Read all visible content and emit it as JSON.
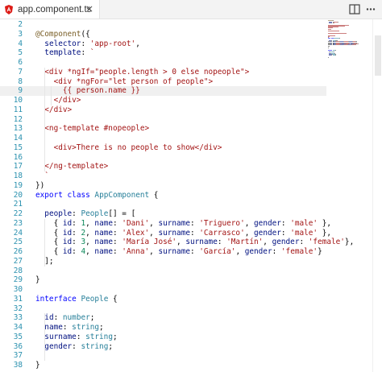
{
  "tab": {
    "filename": "app.component.ts",
    "close_glyph": "×",
    "icon": "angular-icon"
  },
  "toolbar": {
    "split_icon": "split-editor-icon",
    "more_icon": "more-actions-icon"
  },
  "editor": {
    "current_line": 9,
    "lines": [
      {
        "n": "2",
        "t": []
      },
      {
        "n": "3",
        "t": [
          [
            "t-deco",
            "@Component"
          ],
          [
            "t-pun",
            "({"
          ]
        ]
      },
      {
        "n": "4",
        "t": [
          [
            "t-pun",
            "  "
          ],
          [
            "t-prop",
            "selector"
          ],
          [
            "t-pun",
            ": "
          ],
          [
            "t-str",
            "'app-root'"
          ],
          [
            "t-pun",
            ","
          ]
        ]
      },
      {
        "n": "5",
        "t": [
          [
            "t-pun",
            "  "
          ],
          [
            "t-prop",
            "template"
          ],
          [
            "t-pun",
            ": "
          ],
          [
            "t-str",
            "`"
          ]
        ]
      },
      {
        "n": "6",
        "t": []
      },
      {
        "n": "7",
        "t": [
          [
            "t-str",
            "  <div *ngIf=\"people.length > 0 else nopeople\">"
          ]
        ]
      },
      {
        "n": "8",
        "t": [
          [
            "t-str",
            "    <div *ngFor=\"let person of people\">"
          ]
        ]
      },
      {
        "n": "9",
        "t": [
          [
            "t-str",
            "      {{ person.name }}"
          ]
        ]
      },
      {
        "n": "10",
        "t": [
          [
            "t-str",
            "    </div>"
          ]
        ]
      },
      {
        "n": "11",
        "t": [
          [
            "t-str",
            "  </div>"
          ]
        ]
      },
      {
        "n": "12",
        "t": []
      },
      {
        "n": "13",
        "t": [
          [
            "t-str",
            "  <ng-template #nopeople>"
          ]
        ]
      },
      {
        "n": "14",
        "t": []
      },
      {
        "n": "15",
        "t": [
          [
            "t-str",
            "    <div>There is no people to show</div>"
          ]
        ]
      },
      {
        "n": "16",
        "t": []
      },
      {
        "n": "17",
        "t": [
          [
            "t-str",
            "  </ng-template>"
          ]
        ]
      },
      {
        "n": "18",
        "t": [
          [
            "t-str",
            "  `"
          ]
        ]
      },
      {
        "n": "19",
        "t": [
          [
            "t-pun",
            "})"
          ]
        ]
      },
      {
        "n": "20",
        "t": [
          [
            "t-key",
            "export"
          ],
          [
            "t-pun",
            " "
          ],
          [
            "t-key",
            "class"
          ],
          [
            "t-pun",
            " "
          ],
          [
            "t-type",
            "AppComponent"
          ],
          [
            "t-pun",
            " {"
          ]
        ]
      },
      {
        "n": "21",
        "t": []
      },
      {
        "n": "22",
        "t": [
          [
            "t-pun",
            "  "
          ],
          [
            "t-prop",
            "people"
          ],
          [
            "t-pun",
            ": "
          ],
          [
            "t-type",
            "People"
          ],
          [
            "t-pun",
            "[] = ["
          ]
        ]
      },
      {
        "n": "23",
        "t": [
          [
            "t-pun",
            "    { "
          ],
          [
            "t-prop",
            "id"
          ],
          [
            "t-pun",
            ": "
          ],
          [
            "t-num",
            "1"
          ],
          [
            "t-pun",
            ", "
          ],
          [
            "t-prop",
            "name"
          ],
          [
            "t-pun",
            ": "
          ],
          [
            "t-str",
            "'Dani'"
          ],
          [
            "t-pun",
            ", "
          ],
          [
            "t-prop",
            "surname"
          ],
          [
            "t-pun",
            ": "
          ],
          [
            "t-str",
            "'Triguero'"
          ],
          [
            "t-pun",
            ", "
          ],
          [
            "t-prop",
            "gender"
          ],
          [
            "t-pun",
            ": "
          ],
          [
            "t-str",
            "'male'"
          ],
          [
            "t-pun",
            " },"
          ]
        ]
      },
      {
        "n": "24",
        "t": [
          [
            "t-pun",
            "    { "
          ],
          [
            "t-prop",
            "id"
          ],
          [
            "t-pun",
            ": "
          ],
          [
            "t-num",
            "2"
          ],
          [
            "t-pun",
            ", "
          ],
          [
            "t-prop",
            "name"
          ],
          [
            "t-pun",
            ": "
          ],
          [
            "t-str",
            "'Alex'"
          ],
          [
            "t-pun",
            ", "
          ],
          [
            "t-prop",
            "surname"
          ],
          [
            "t-pun",
            ": "
          ],
          [
            "t-str",
            "'Carrasco'"
          ],
          [
            "t-pun",
            ", "
          ],
          [
            "t-prop",
            "gender"
          ],
          [
            "t-pun",
            ": "
          ],
          [
            "t-str",
            "'male'"
          ],
          [
            "t-pun",
            " },"
          ]
        ]
      },
      {
        "n": "25",
        "t": [
          [
            "t-pun",
            "    { "
          ],
          [
            "t-prop",
            "id"
          ],
          [
            "t-pun",
            ": "
          ],
          [
            "t-num",
            "3"
          ],
          [
            "t-pun",
            ", "
          ],
          [
            "t-prop",
            "name"
          ],
          [
            "t-pun",
            ": "
          ],
          [
            "t-str",
            "'María José'"
          ],
          [
            "t-pun",
            ", "
          ],
          [
            "t-prop",
            "surname"
          ],
          [
            "t-pun",
            ": "
          ],
          [
            "t-str",
            "'Martín'"
          ],
          [
            "t-pun",
            ", "
          ],
          [
            "t-prop",
            "gender"
          ],
          [
            "t-pun",
            ": "
          ],
          [
            "t-str",
            "'female'"
          ],
          [
            "t-pun",
            "},"
          ]
        ]
      },
      {
        "n": "26",
        "t": [
          [
            "t-pun",
            "    { "
          ],
          [
            "t-prop",
            "id"
          ],
          [
            "t-pun",
            ": "
          ],
          [
            "t-num",
            "4"
          ],
          [
            "t-pun",
            ", "
          ],
          [
            "t-prop",
            "name"
          ],
          [
            "t-pun",
            ": "
          ],
          [
            "t-str",
            "'Anna'"
          ],
          [
            "t-pun",
            ", "
          ],
          [
            "t-prop",
            "surname"
          ],
          [
            "t-pun",
            ": "
          ],
          [
            "t-str",
            "'García'"
          ],
          [
            "t-pun",
            ", "
          ],
          [
            "t-prop",
            "gender"
          ],
          [
            "t-pun",
            ": "
          ],
          [
            "t-str",
            "'female'"
          ],
          [
            "t-pun",
            "}"
          ]
        ]
      },
      {
        "n": "27",
        "t": [
          [
            "t-pun",
            "  ];"
          ]
        ]
      },
      {
        "n": "28",
        "t": []
      },
      {
        "n": "29",
        "t": [
          [
            "t-pun",
            "}"
          ]
        ]
      },
      {
        "n": "30",
        "t": []
      },
      {
        "n": "31",
        "t": [
          [
            "t-key",
            "interface"
          ],
          [
            "t-pun",
            " "
          ],
          [
            "t-type",
            "People"
          ],
          [
            "t-pun",
            " {"
          ]
        ]
      },
      {
        "n": "32",
        "t": []
      },
      {
        "n": "33",
        "t": [
          [
            "t-pun",
            "  "
          ],
          [
            "t-prop",
            "id"
          ],
          [
            "t-pun",
            ": "
          ],
          [
            "t-type",
            "number"
          ],
          [
            "t-pun",
            ";"
          ]
        ]
      },
      {
        "n": "34",
        "t": [
          [
            "t-pun",
            "  "
          ],
          [
            "t-prop",
            "name"
          ],
          [
            "t-pun",
            ": "
          ],
          [
            "t-type",
            "string"
          ],
          [
            "t-pun",
            ";"
          ]
        ]
      },
      {
        "n": "35",
        "t": [
          [
            "t-pun",
            "  "
          ],
          [
            "t-prop",
            "surname"
          ],
          [
            "t-pun",
            ": "
          ],
          [
            "t-type",
            "string"
          ],
          [
            "t-pun",
            ";"
          ]
        ]
      },
      {
        "n": "36",
        "t": [
          [
            "t-pun",
            "  "
          ],
          [
            "t-prop",
            "gender"
          ],
          [
            "t-pun",
            ": "
          ],
          [
            "t-type",
            "string"
          ],
          [
            "t-pun",
            ";"
          ]
        ]
      },
      {
        "n": "37",
        "t": []
      },
      {
        "n": "38",
        "t": [
          [
            "t-pun",
            "}"
          ]
        ]
      }
    ]
  },
  "colors": {
    "line_number": "#2b91af",
    "keyword": "#0000ff",
    "string": "#a31515",
    "type": "#267f99",
    "decorator": "#795e26"
  }
}
